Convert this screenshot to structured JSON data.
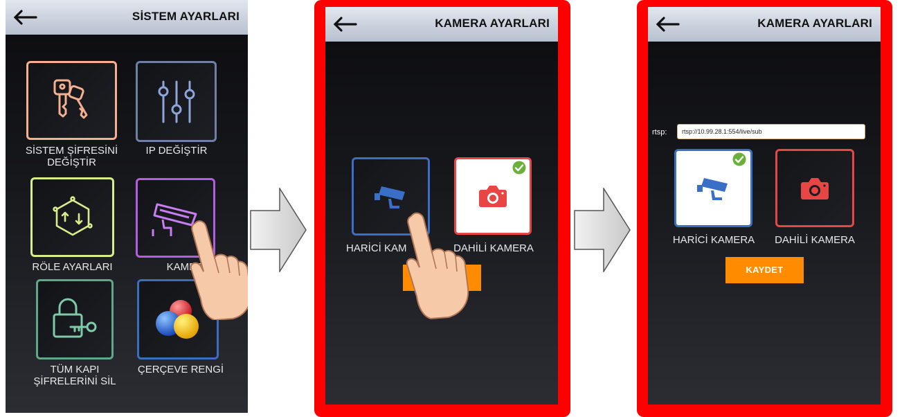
{
  "screen1": {
    "title": "SİSTEM AYARLARI",
    "back_icon": "arrow-left-icon",
    "tiles": [
      {
        "label_line1": "SİSTEM ŞİFRESİNİ",
        "label_line2": "DEĞİŞTİR",
        "icon": "keys-icon",
        "color": "#f4b08f"
      },
      {
        "label_line1": "IP DEĞİŞTİR",
        "label_line2": "",
        "icon": "sliders-icon",
        "color": "#6f7fa6"
      },
      {
        "label_line1": "RÖLE AYARLARI",
        "label_line2": "",
        "icon": "relay-circuit-icon",
        "color": "#d8ee8a"
      },
      {
        "label_line1": "KAMERA",
        "label_line2": "",
        "icon": "camera-icon",
        "color": "#b15fe0"
      },
      {
        "label_line1": "TÜM KAPI",
        "label_line2": "ŞİFRELERİNİ SİL",
        "icon": "lock-key-icon",
        "color": "#5fa88a"
      },
      {
        "label_line1": "ÇERÇEVE RENGİ",
        "label_line2": "",
        "icon": "color-balls-icon",
        "color": "#3b6dc1"
      }
    ],
    "kamera_partial_label": "KAMER"
  },
  "screen2": {
    "title": "KAMERA AYARLARI",
    "back_icon": "arrow-left-icon",
    "external_label": "HARİCİ KAMERA",
    "external_partial_label": "HARİCİ KAM",
    "internal_label": "DAHİLİ KAMERA",
    "selected": "internal",
    "save_label": "KAYDET"
  },
  "screen3": {
    "title": "KAMERA AYARLARI",
    "back_icon": "arrow-left-icon",
    "rtsp_label": "rtsp:",
    "rtsp_value": "rtsp://10.99.28.1:554/live/sub",
    "external_label": "HARİCİ KAMERA",
    "internal_label": "DAHİLİ KAMERA",
    "selected": "external",
    "save_label": "KAYDET"
  },
  "colors": {
    "highlight_frame": "#ff0000",
    "save_button": "#ff8c00",
    "external_blue": "#3a6fc7",
    "internal_red": "#e84545",
    "check_green": "#6ab13c"
  }
}
